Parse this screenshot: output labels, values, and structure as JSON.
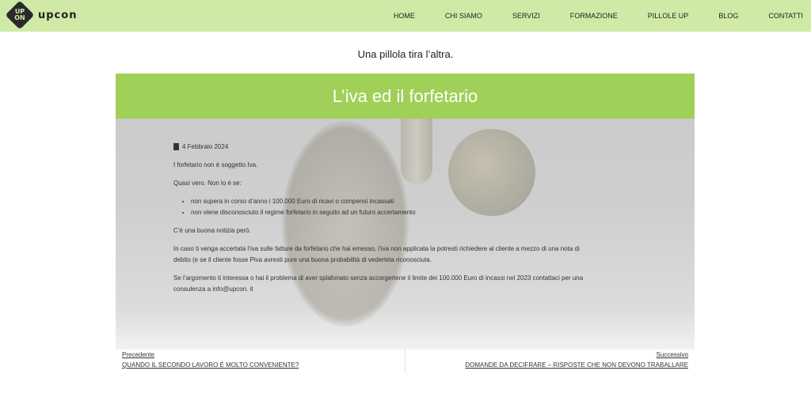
{
  "header": {
    "logo_mark": "UP ON",
    "logo_text": "upcon",
    "nav": [
      "HOME",
      "CHI SIAMO",
      "SERVIZI",
      "FORMAZIONE",
      "PILLOLE UP",
      "BLOG",
      "CONTATTI"
    ]
  },
  "tagline": "Una pillola tira l’altra.",
  "post": {
    "title": "L’iva ed il forfetario",
    "date": "4 Febbraio 2024",
    "p1": "I forfetario non è soggetto Iva.",
    "p2": "Quasi vero. Non lo è se:",
    "bullets": [
      "non supera in corso d’anno i 100.000 Euro di ricavi o compensi incassati",
      "non viene disconosciuto il regime forfetario in seguito ad un futuro accertamento"
    ],
    "p3": "C’è una buona notizia però.",
    "p4": "In caso ti venga accertata l’iva sulle fatture da forfetario che hai emesso, l’iva non applicata la potresti richiedere al cliente a mezzo di una nota di debito (e se il cliente fosse Piva avresti pure una buona probabilità di vedertela riconosciuta.",
    "p5": "Se l’argomento ti interessa o hai il problema di aver splafonato senza accorgertene il limite dei 100.000 Euro di incassi nel 2023 contattaci per una consulenza a info@upcon. it"
  },
  "post_nav": {
    "prev_label": "Precedente",
    "prev_title": "QUANDO IL SECONDO LAVORO È MOLTO CONVENIENTE?",
    "next_label": "Successivo",
    "next_title": "DOMANDE DA DECIFRARE – RISPOSTE CHE NON DEVONO TRABALLARE"
  },
  "colors": {
    "topbar": "#cfeaa6",
    "title_band": "#a0d057"
  }
}
